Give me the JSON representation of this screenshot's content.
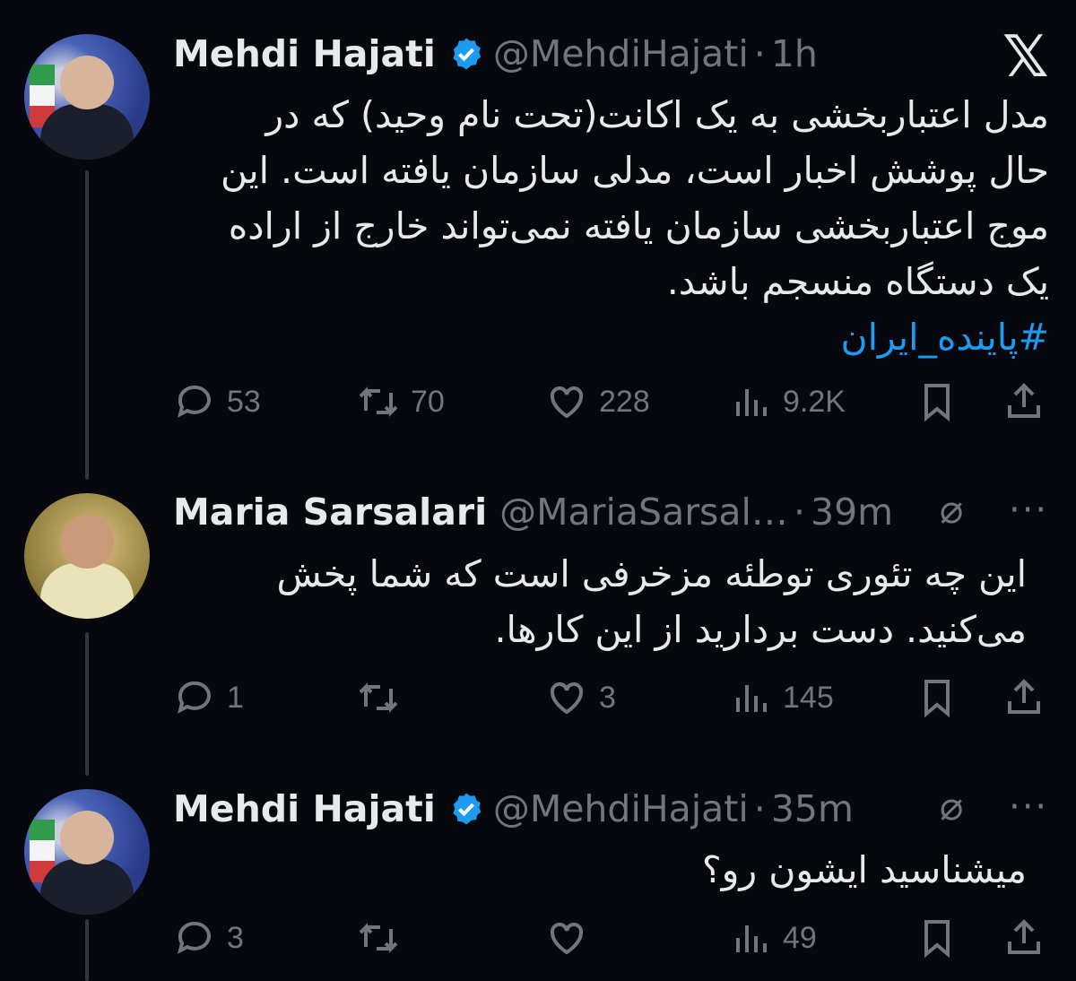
{
  "x_logo": "𝕏",
  "tweets": [
    {
      "name": "Mehdi Hajati",
      "handle": "@MehdiHajati",
      "time": "1h",
      "text_lines": [
        "مدل اعتباربخشی به یک اکانت(تحت نام وحید) که در",
        "حال پوشش اخبار است، مدلی سازمان یافته است. این",
        "موج اعتباربخشی سازمان یافته نمی‌تواند خارج از اراده",
        "یک دستگاه منسجم باشد."
      ],
      "hashtag": "#پاینده_ایران",
      "replies": "53",
      "retweets": "70",
      "likes": "228",
      "views": "9.2K"
    },
    {
      "name": "Maria Sarsalari",
      "handle": "@MariaSarsal…",
      "time": "39m",
      "text_lines": [
        "این چه تئوری توطئه مزخرفی است که شما پخش",
        "می‌کنید. دست بردارید از این کارها."
      ],
      "replies": "1",
      "retweets": "",
      "likes": "3",
      "views": "145"
    },
    {
      "name": "Mehdi Hajati",
      "handle": "@MehdiHajati",
      "time": "35m",
      "text_lines": [
        "میشناسید ایشون رو؟"
      ],
      "replies": "3",
      "retweets": "",
      "likes": "",
      "views": "49"
    }
  ],
  "colors": {
    "background": "#06080d",
    "text": "#e7e9ea",
    "muted": "#71767b",
    "accent": "#1d9bf0"
  }
}
